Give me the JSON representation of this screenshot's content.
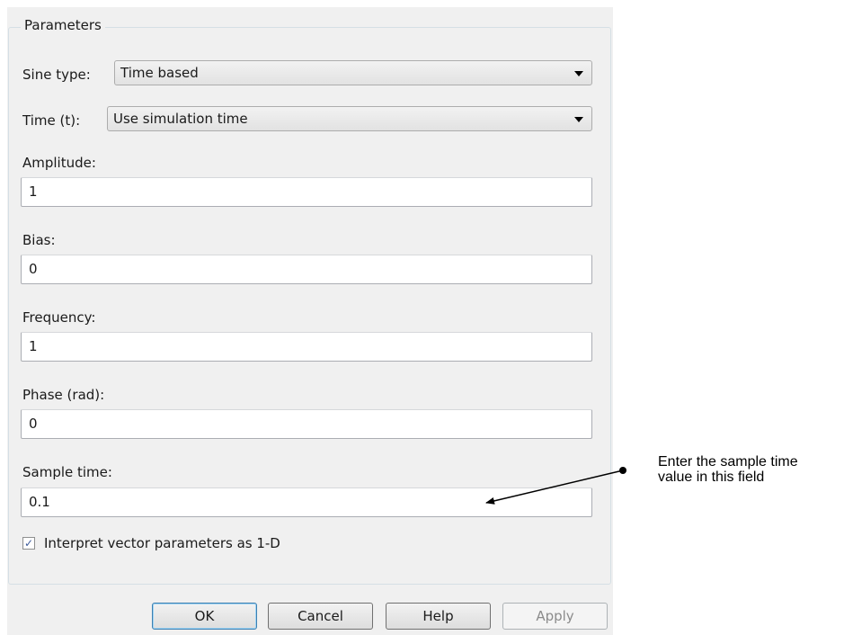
{
  "dialog": {
    "group_title": "Parameters",
    "sine_type": {
      "label": "Sine type:",
      "value": "Time based"
    },
    "time": {
      "label": "Time (t):",
      "value": "Use simulation time"
    },
    "amplitude": {
      "label": "Amplitude:",
      "value": "1"
    },
    "bias": {
      "label": "Bias:",
      "value": "0"
    },
    "frequency": {
      "label": "Frequency:",
      "value": "1"
    },
    "phase": {
      "label": "Phase (rad):",
      "value": "0"
    },
    "sample_time": {
      "label": "Sample time:",
      "value": "0.1"
    },
    "interpret_vector": {
      "label": "Interpret vector parameters as 1-D",
      "checked": true,
      "check_glyph": "✓"
    }
  },
  "buttons": {
    "ok": "OK",
    "cancel": "Cancel",
    "help": "Help",
    "apply": "Apply"
  },
  "annotation": {
    "line1": "Enter the sample time",
    "line2": "value in this field"
  },
  "icons": {
    "dropdown": "chevron-down-icon",
    "checkbox": "check-icon"
  }
}
